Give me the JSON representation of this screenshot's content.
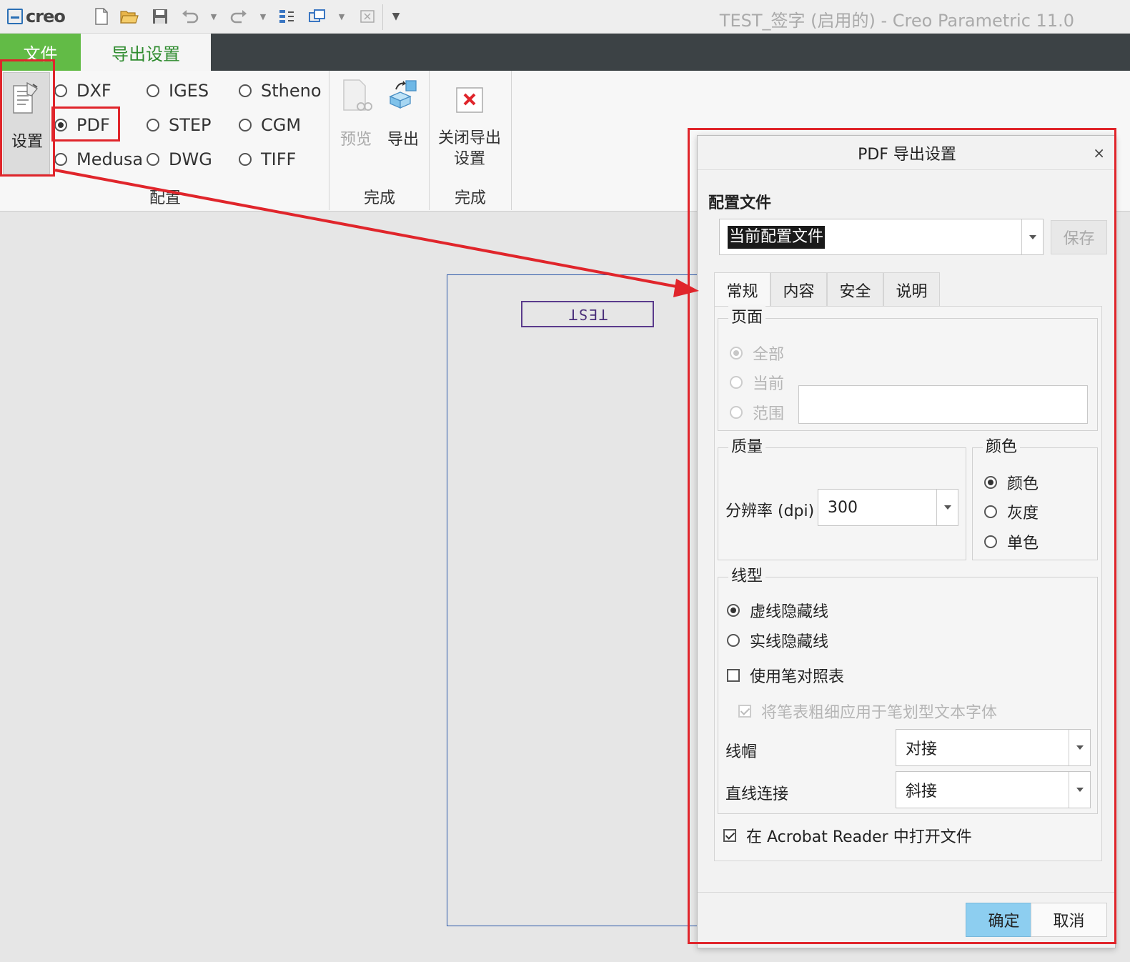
{
  "app": {
    "logo_text": "creo",
    "window_title": "TEST_签字 (启用的) - Creo Parametric 11.0"
  },
  "tabs": {
    "file": "文件",
    "export_settings": "导出设置"
  },
  "ribbon": {
    "settings_label": "设置",
    "formats": {
      "dxf": "DXF",
      "pdf": "PDF",
      "medusa": "Medusa",
      "iges": "IGES",
      "step": "STEP",
      "dwg": "DWG",
      "stheno": "Stheno",
      "cgm": "CGM",
      "tiff": "TIFF"
    },
    "selected_format": "PDF",
    "group_config": "配置",
    "preview_label": "预览",
    "export_label": "导出",
    "group_done_1": "完成",
    "close_label_line1": "关闭导出",
    "close_label_line2": "设置",
    "group_done_2": "完成"
  },
  "drawing": {
    "text": "TEST"
  },
  "dialog": {
    "title": "PDF 导出设置",
    "close_glyph": "×",
    "profile_label": "配置文件",
    "profile_value": "当前配置文件",
    "save_label": "保存",
    "tabs": [
      "常规",
      "内容",
      "安全",
      "说明"
    ],
    "active_tab": "常规",
    "page": {
      "legend": "页面",
      "all": "全部",
      "current": "当前",
      "range": "范围",
      "range_value": ""
    },
    "quality": {
      "legend": "质量",
      "dpi_label": "分辨率 (dpi)",
      "dpi_value": "300"
    },
    "color": {
      "legend": "颜色",
      "color": "颜色",
      "gray": "灰度",
      "mono": "单色",
      "selected": "颜色"
    },
    "linetype": {
      "legend": "线型",
      "dashed_hidden": "虚线隐藏线",
      "solid_hidden": "实线隐藏线",
      "selected": "虚线隐藏线",
      "use_pen_table": "使用笔对照表",
      "use_pen_table_checked": false,
      "apply_pen_width": "将笔表粗细应用于笔划型文本字体",
      "apply_pen_width_checked": true,
      "line_cap_label": "线帽",
      "line_cap_value": "对接",
      "line_join_label": "直线连接",
      "line_join_value": "斜接"
    },
    "open_in_acrobat": "在 Acrobat Reader 中打开文件",
    "open_in_acrobat_checked": true,
    "ok_label": "确定",
    "cancel_label": "取消"
  },
  "colors": {
    "file_tab": "#62bb46",
    "tab_strip": "#3c4245",
    "ok_button": "#8dcef0",
    "annotation_red": "#e0252b"
  }
}
